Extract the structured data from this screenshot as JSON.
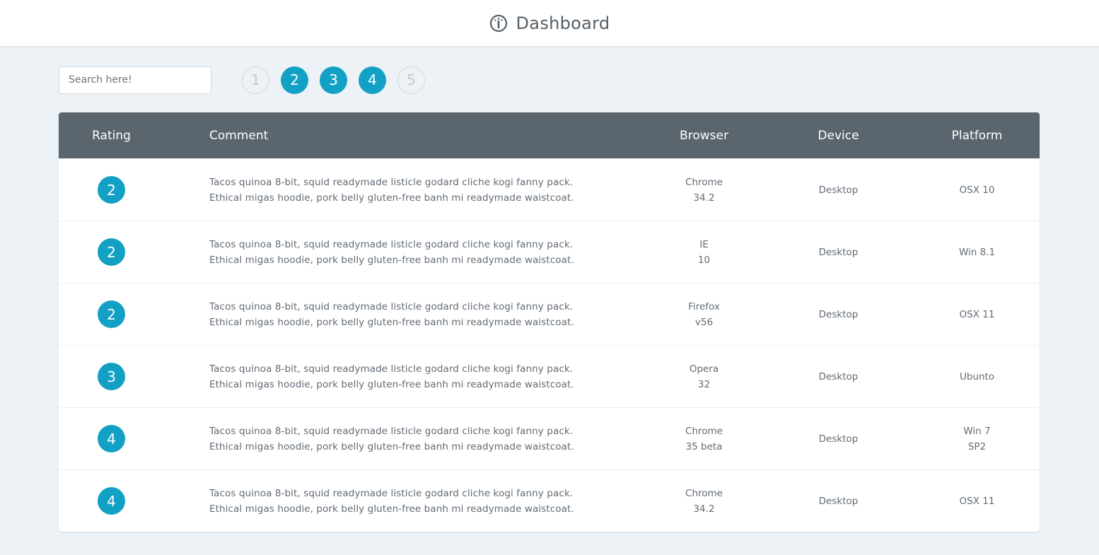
{
  "header": {
    "title": "Dashboard",
    "icon": "dashboard-gauge-icon"
  },
  "search": {
    "placeholder": "Search here!",
    "value": ""
  },
  "pagination": {
    "pages": [
      {
        "label": "1",
        "active": false
      },
      {
        "label": "2",
        "active": true
      },
      {
        "label": "3",
        "active": true
      },
      {
        "label": "4",
        "active": true
      },
      {
        "label": "5",
        "active": false
      }
    ]
  },
  "colors": {
    "accent": "#12a1c5",
    "table_header": "#5b656e",
    "background": "#edf2f6"
  },
  "table": {
    "columns": [
      "Rating",
      "Comment",
      "Browser",
      "Device",
      "Platform"
    ],
    "rows": [
      {
        "rating": "2",
        "comment_line1": "Tacos quinoa 8-bit, squid readymade listicle godard cliche kogi fanny pack.",
        "comment_line2": "Ethical migas hoodie, pork belly gluten-free banh mi readymade waistcoat.",
        "browser_name": "Chrome",
        "browser_version": "34.2",
        "device": "Desktop",
        "platform_line1": "OSX 10",
        "platform_line2": ""
      },
      {
        "rating": "2",
        "comment_line1": "Tacos quinoa 8-bit, squid readymade listicle godard cliche kogi fanny pack.",
        "comment_line2": "Ethical migas hoodie, pork belly gluten-free banh mi readymade waistcoat.",
        "browser_name": "IE",
        "browser_version": "10",
        "device": "Desktop",
        "platform_line1": "Win 8.1",
        "platform_line2": ""
      },
      {
        "rating": "2",
        "comment_line1": "Tacos quinoa 8-bit, squid readymade listicle godard cliche kogi fanny pack.",
        "comment_line2": "Ethical migas hoodie, pork belly gluten-free banh mi readymade waistcoat.",
        "browser_name": "Firefox",
        "browser_version": "v56",
        "device": "Desktop",
        "platform_line1": "OSX 11",
        "platform_line2": ""
      },
      {
        "rating": "3",
        "comment_line1": "Tacos quinoa 8-bit, squid readymade listicle godard cliche kogi fanny pack.",
        "comment_line2": "Ethical migas hoodie, pork belly gluten-free banh mi readymade waistcoat.",
        "browser_name": "Opera",
        "browser_version": "32",
        "device": "Desktop",
        "platform_line1": "Ubunto",
        "platform_line2": ""
      },
      {
        "rating": "4",
        "comment_line1": "Tacos quinoa 8-bit, squid readymade listicle godard cliche kogi fanny pack.",
        "comment_line2": "Ethical migas hoodie, pork belly gluten-free banh mi readymade waistcoat.",
        "browser_name": "Chrome",
        "browser_version": "35 beta",
        "device": "Desktop",
        "platform_line1": "Win 7",
        "platform_line2": "SP2"
      },
      {
        "rating": "4",
        "comment_line1": "Tacos quinoa 8-bit, squid readymade listicle godard cliche kogi fanny pack.",
        "comment_line2": "Ethical migas hoodie, pork belly gluten-free banh mi readymade waistcoat.",
        "browser_name": "Chrome",
        "browser_version": "34.2",
        "device": "Desktop",
        "platform_line1": "OSX 11",
        "platform_line2": ""
      }
    ]
  }
}
